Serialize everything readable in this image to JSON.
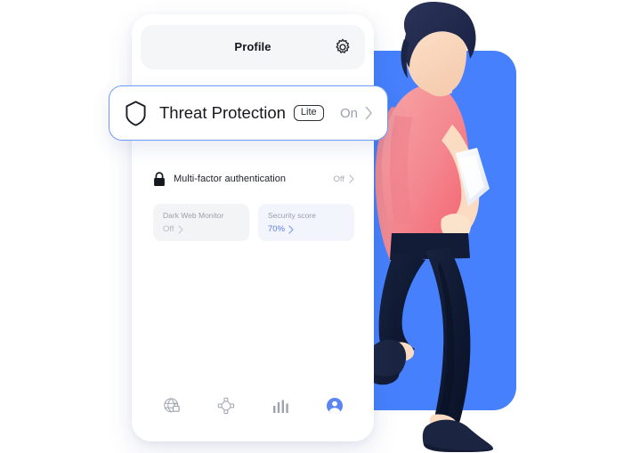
{
  "app": {
    "screen_title": "Profile",
    "settings_icon": "gear-icon"
  },
  "highlight_card": {
    "icon": "shield-icon",
    "title": "Threat Protection",
    "badge": "Lite",
    "state": "On",
    "chevron": "chevron-right-icon",
    "border_color": "#6d9bfb"
  },
  "rows": [
    {
      "icon": "lock-icon",
      "label": "Multi-factor authentication",
      "state": "Off",
      "chevron": "chevron-right-icon"
    }
  ],
  "mini_cards": [
    {
      "title": "Dark Web Monitor",
      "value": "Off",
      "chevron": "chevron-right-icon",
      "value_color": "#b5bac4"
    },
    {
      "title": "Security score",
      "value": "70%",
      "chevron": "chevron-right-icon",
      "value_color": "#5b7ce8"
    }
  ],
  "bottom_nav": [
    {
      "icon": "globe-lock-icon",
      "active": false
    },
    {
      "icon": "mesh-network-icon",
      "active": false
    },
    {
      "icon": "bar-chart-icon",
      "active": false
    },
    {
      "icon": "profile-avatar-icon",
      "active": true
    }
  ],
  "theme": {
    "accent_blue": "#4680fc",
    "panel_blue": "#4680fc",
    "shirt_pink": "#f2848c",
    "hair_navy": "#222a4a",
    "pants_navy": "#101a33",
    "skin": "#fbddc4",
    "muted_text": "#9aa0ac"
  }
}
